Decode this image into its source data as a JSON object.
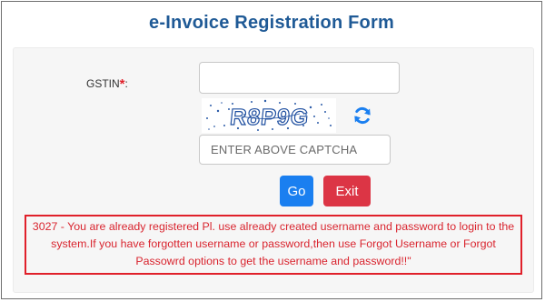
{
  "header": {
    "title": "e-Invoice Registration Form"
  },
  "form": {
    "gstin_label": "GSTIN",
    "required_mark": "*",
    "colon": ":",
    "gstin_value": "",
    "captcha_text": "R8P9G",
    "captcha_placeholder": "ENTER ABOVE CAPTCHA",
    "go_label": "Go",
    "exit_label": "Exit"
  },
  "error": {
    "message": "3027 - You are already registered Pl. use already created username and password to login to the system.If you have forgotten username or password,then use Forgot Username or Forgot Passowrd options to get the username and password!!\""
  },
  "icons": {
    "refresh": "refresh-icon"
  },
  "colors": {
    "title": "#1f5a96",
    "go_button": "#1a7ff0",
    "exit_button": "#dc3545",
    "error": "#d9252f",
    "captcha_text": "#1f4fa0"
  }
}
